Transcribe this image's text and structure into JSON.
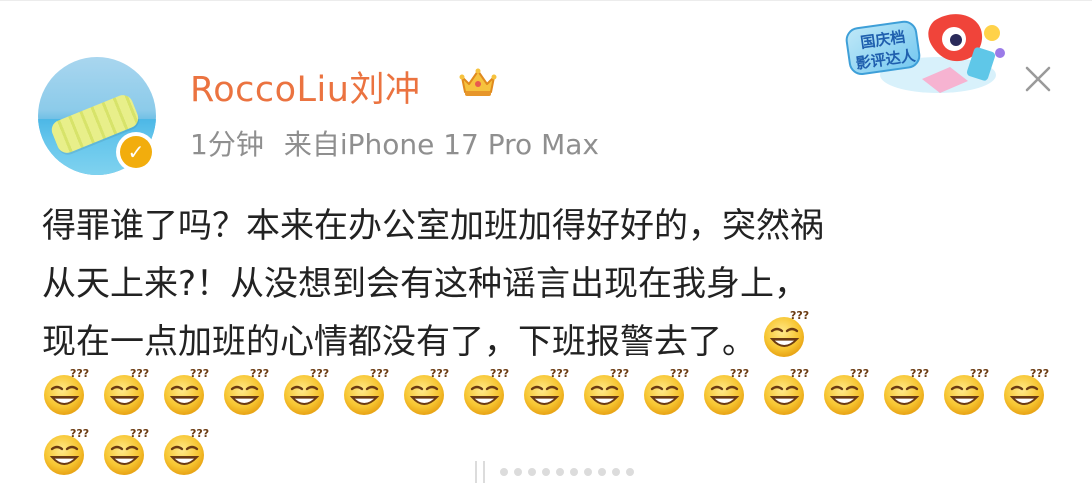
{
  "post": {
    "author": "RoccoLiu刘冲",
    "time": "1分钟",
    "source": "来自iPhone 17 Pro Max",
    "text_lines": [
      "得罪谁了吗？本来在办公室加班加得好好的，突然祸",
      "从天上来?！从没想到会有这种谣言出现在我身上，",
      "现在一点加班的心情都没有了，下班报警去了。"
    ],
    "emoji_name": "confused-grin-emoji",
    "emoji_rows": [
      1,
      17,
      3
    ]
  },
  "badge": {
    "line1": "国庆档",
    "line2": "影评达人"
  },
  "icons": {
    "verified": "verified-badge-icon",
    "crown": "crown-icon",
    "close": "close-icon"
  },
  "colors": {
    "username": "#eb7340",
    "meta": "#8f8f8f",
    "text": "#222222",
    "verified": "#f2ad0d"
  }
}
